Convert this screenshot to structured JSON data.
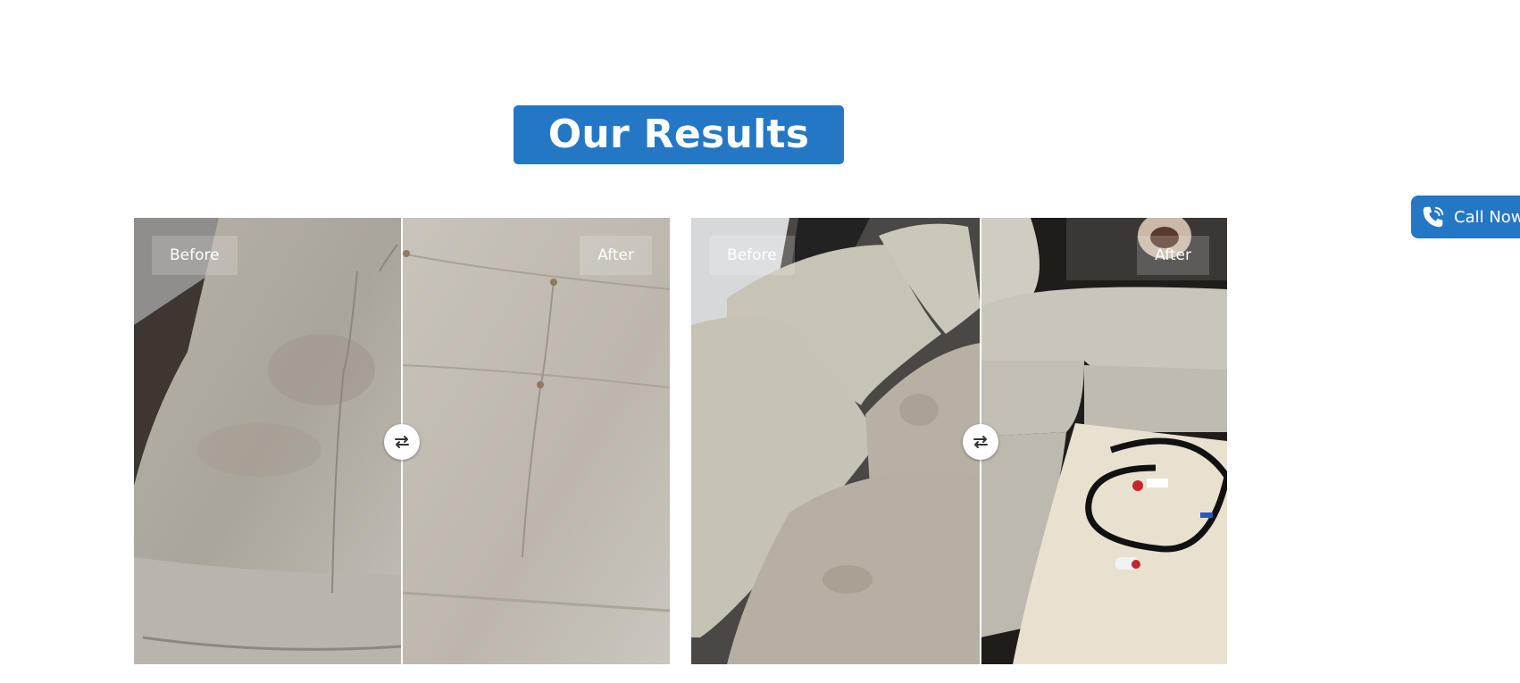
{
  "section": {
    "title": "Our Results"
  },
  "comparisons": [
    {
      "before_label": "Before",
      "after_label": "After",
      "split_position_percent": 50
    },
    {
      "before_label": "Before",
      "after_label": "After",
      "split_position_percent": 54
    }
  ],
  "call_now": {
    "label": "Call Now"
  },
  "colors": {
    "accent": "#2477c5",
    "label_text": "#ffffff"
  },
  "icons": {
    "handle": "swap-arrows-icon",
    "call": "phone-icon"
  }
}
